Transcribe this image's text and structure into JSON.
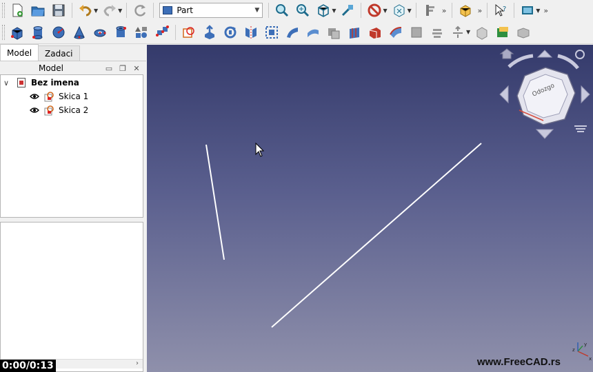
{
  "toolbar_top": {
    "workbench": "Part"
  },
  "combo": {
    "tabs": [
      {
        "label": "Model"
      },
      {
        "label": "Zadaci"
      }
    ],
    "panel_title": "Model",
    "tree": {
      "document": "Bez imena",
      "items": [
        {
          "label": "Skica 1"
        },
        {
          "label": "Skica 2"
        }
      ]
    }
  },
  "view": {
    "navcube_face": "Odozgo",
    "watermark": "www.FreeCAD.rs"
  },
  "video": {
    "timestamp": "0:00/0:13"
  },
  "colors": {
    "view_top": "#343a6b",
    "view_bottom": "#8f90ab",
    "sketch_line": "#ffffff"
  }
}
